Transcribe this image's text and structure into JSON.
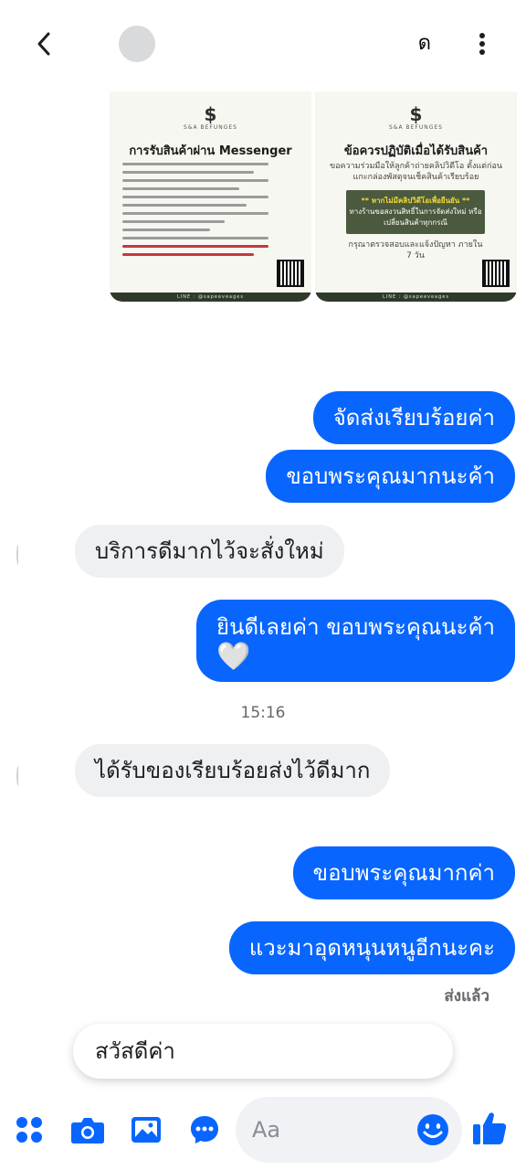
{
  "header": {
    "contact_name": "ด",
    "back_icon": "chevron-left-icon",
    "more_icon": "vertical-ellipsis-icon"
  },
  "cards": [
    {
      "brand": "S&A BEFUNGES",
      "title": "การรับสินค้าผ่าน Messenger",
      "footer": "LINE : @sapeeveages"
    },
    {
      "brand": "S&A BEFUNGES",
      "title": "ข้อควรปฏิบัติเมื่อได้รับสินค้า",
      "subtitle": "ขอความร่วมมือให้ลูกค้าถ่ายคลิปวิดีโอ ตั้งแต่ก่อนแกะกล่องพัสดุจนเช็คสินค้าเรียบร้อย",
      "box_highlight": "** หากไม่มีคลิปวิดีโอเพื่อยืนยัน **",
      "box_text": "ทางร้านขอสงวนสิทธิ์ในการจัดส่งใหม่ หรือเปลี่ยนสินค้าทุกกรณี",
      "note": "กรุณาตรวจสอบและแจ้งปัญหา ภายใน 7 วัน",
      "footer": "LINE : @sapeeveages"
    }
  ],
  "messages": {
    "m1": "จัดส่งเรียบร้อยค่า",
    "m2": "ขอบพระคุณมากนะค้า",
    "m3": "บริการดีมากไว้จะสั่งใหม่",
    "m4": "ยินดีเลยค่า ขอบพระคุณนะค้า",
    "m4_emoji": "🤍",
    "time": "15:16",
    "m5": "ได้รับของเรียบร้อยส่งไว้ดีมาก",
    "m6": "ขอบพระคุณมากค่า",
    "m7": "แวะมาอุดหนุนหนูอีกนะคะ",
    "status": "ส่งแล้ว"
  },
  "quick_reply": "สวัสดีค่า",
  "composer": {
    "placeholder": "Aa",
    "icons": [
      "menu-dots-icon",
      "camera-icon",
      "image-icon",
      "chat-bubble-icon",
      "emoji-icon",
      "thumbs-up-icon"
    ]
  },
  "colors": {
    "accent": "#0866ff",
    "incoming_bubble": "#eff0f2"
  }
}
